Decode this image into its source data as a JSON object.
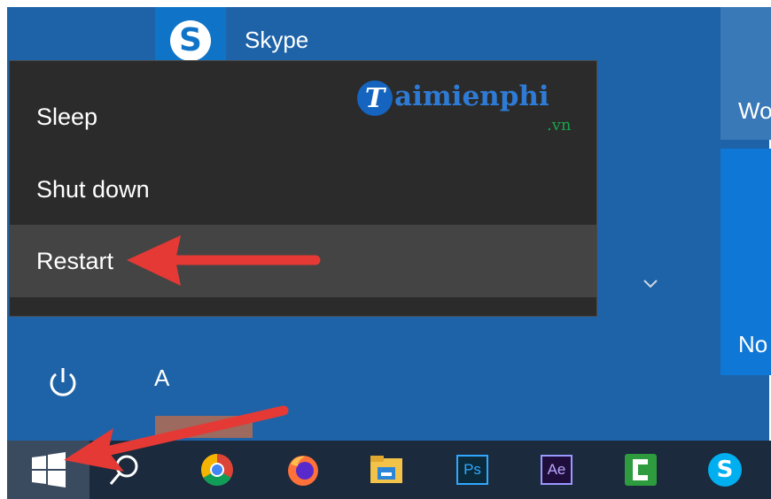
{
  "start_menu": {
    "pinned_app": {
      "label": "Skype",
      "icon": "skype-icon"
    },
    "right_tiles": [
      {
        "label": "Wo"
      },
      {
        "label": "No"
      }
    ],
    "expand_icon": "chevron-down-icon",
    "power_icon": "power-icon",
    "app_list_letter": "A"
  },
  "power_menu": {
    "items": [
      {
        "label": "Sleep"
      },
      {
        "label": "Shut down"
      },
      {
        "label": "Restart"
      }
    ],
    "highlighted": "Restart"
  },
  "watermark": {
    "initial": "T",
    "text": "aimienphi",
    "suffix": ".vn"
  },
  "taskbar": {
    "items": [
      {
        "icon": "windows-start-icon"
      },
      {
        "icon": "search-icon"
      },
      {
        "icon": "chrome-icon"
      },
      {
        "icon": "firefox-icon"
      },
      {
        "icon": "file-explorer-icon"
      },
      {
        "icon": "photoshop-icon",
        "label": "Ps"
      },
      {
        "icon": "after-effects-icon",
        "label": "Ae"
      },
      {
        "icon": "camtasia-icon"
      },
      {
        "icon": "skype-icon",
        "label": "S"
      }
    ]
  },
  "colors": {
    "start_background": "#1e63a8",
    "menu_background": "#2b2b2b",
    "menu_highlight": "#444444",
    "annotation_arrow": "#e53935"
  }
}
